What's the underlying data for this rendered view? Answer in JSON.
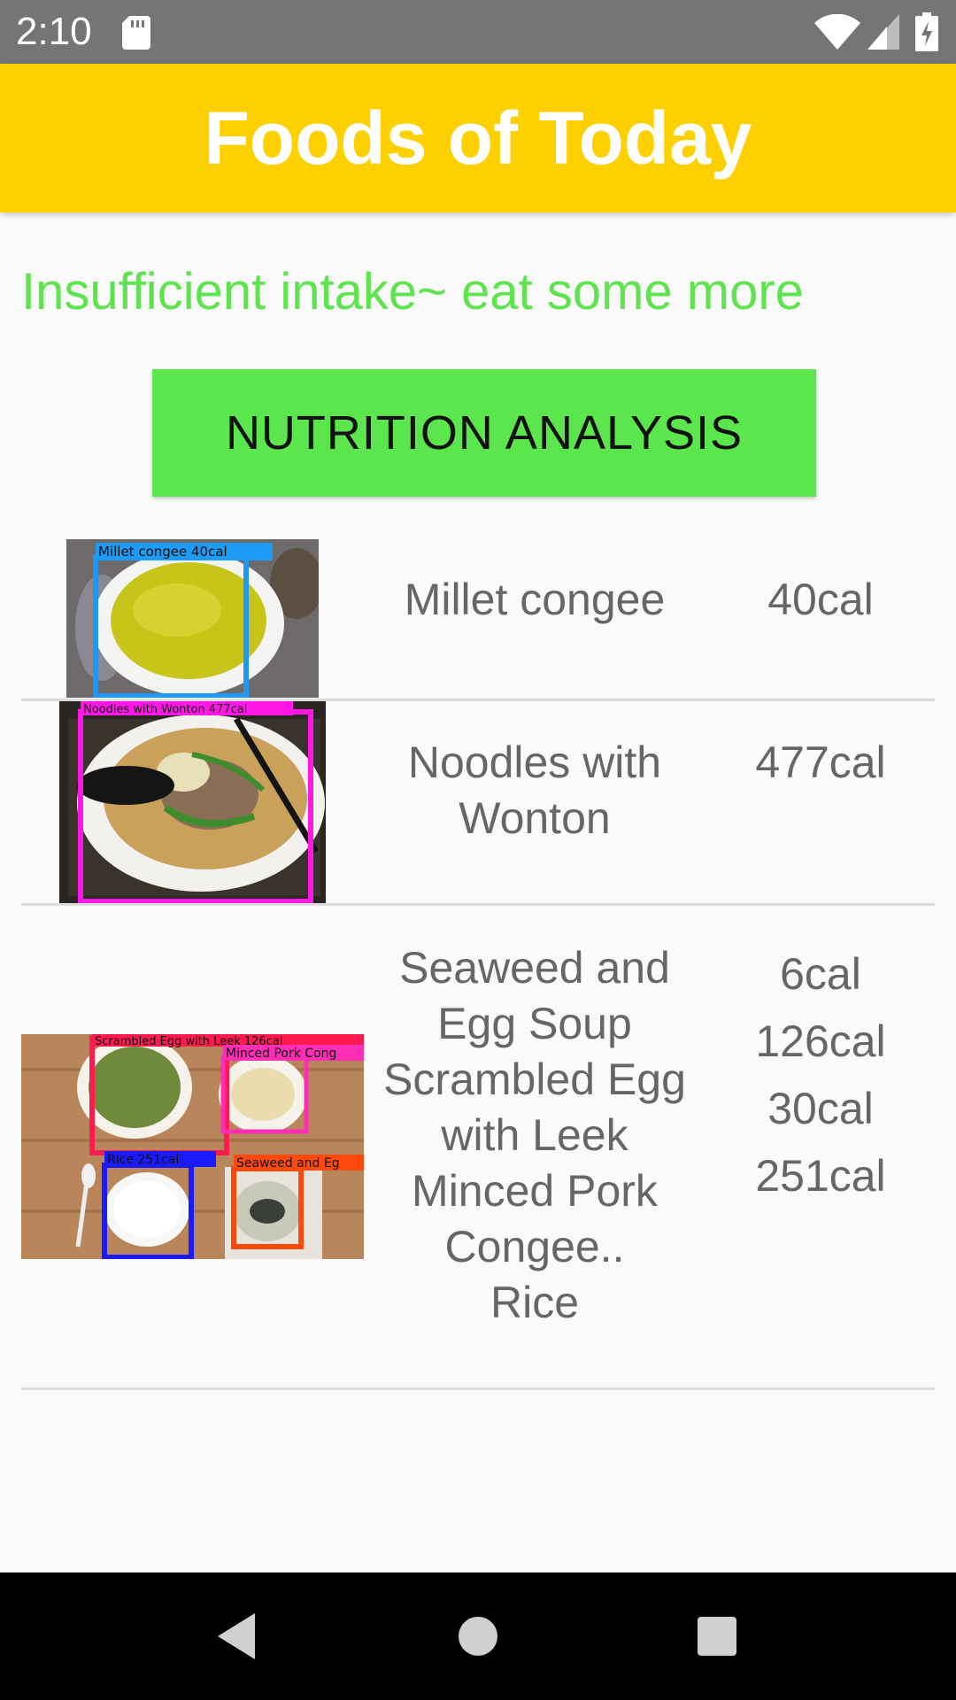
{
  "status_bar": {
    "time": "2:10",
    "icons": [
      "sd-card-icon",
      "wifi-icon",
      "signal-icon",
      "battery-charging-icon"
    ]
  },
  "app_bar": {
    "title": "Foods of Today",
    "background": "#ffd000"
  },
  "message": {
    "text": "Insufficient intake~ eat some more",
    "color": "#5fe34f"
  },
  "analysis_button": {
    "label": "NUTRITION ANALYSIS",
    "background": "#5be64d"
  },
  "foods": [
    {
      "name": "Millet congee",
      "calories": "40cal",
      "image_labels": [
        "Millet congee 40cal"
      ]
    },
    {
      "name": "Noodles with\nWonton",
      "calories": "477cal",
      "image_labels": [
        "Noodles with Wonton 477cal"
      ]
    },
    {
      "name": "Seaweed and\nEgg Soup\nScrambled Egg\nwith Leek\nMinced Pork\nCongee..\nRice",
      "calories": "6cal\n126cal\n30cal\n251cal",
      "image_labels": [
        "Scrambled Egg with Leek 126cal",
        "Minced Pork Cong",
        "Rice 251cal",
        "Seaweed and Eg"
      ]
    }
  ],
  "nav_bar": {
    "icons": [
      "back-icon",
      "home-icon",
      "recent-apps-icon"
    ]
  }
}
